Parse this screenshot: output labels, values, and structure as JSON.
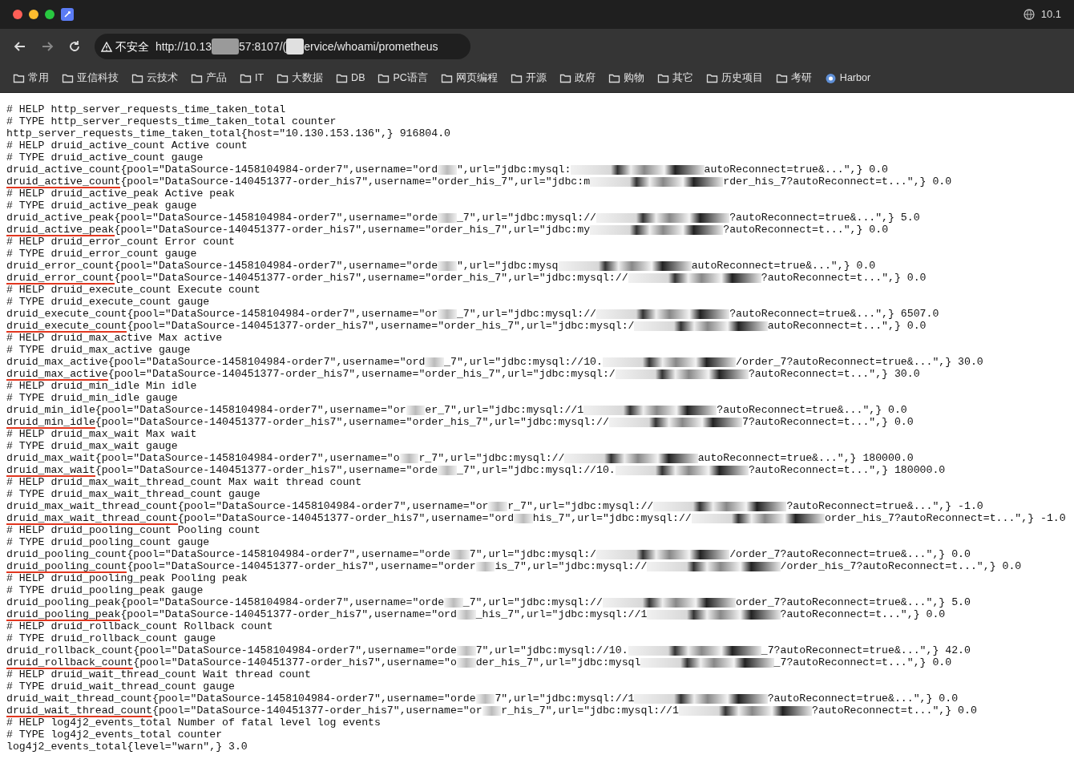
{
  "window": {
    "top_right_text": "10.1"
  },
  "address_bar": {
    "security_label": "不安全",
    "url_parts": [
      "http://10.13",
      "57:8107/(",
      "ervice/whoami/prometheus"
    ]
  },
  "bookmarks": [
    {
      "label": "常用",
      "kind": "folder"
    },
    {
      "label": "亚信科技",
      "kind": "folder"
    },
    {
      "label": "云技术",
      "kind": "folder"
    },
    {
      "label": "产品",
      "kind": "folder"
    },
    {
      "label": "IT",
      "kind": "folder"
    },
    {
      "label": "大数据",
      "kind": "folder"
    },
    {
      "label": "DB",
      "kind": "folder"
    },
    {
      "label": "PC语言",
      "kind": "folder"
    },
    {
      "label": "网页编程",
      "kind": "folder"
    },
    {
      "label": "开源",
      "kind": "folder"
    },
    {
      "label": "政府",
      "kind": "folder"
    },
    {
      "label": "购物",
      "kind": "folder"
    },
    {
      "label": "其它",
      "kind": "folder"
    },
    {
      "label": "历史项目",
      "kind": "folder"
    },
    {
      "label": "考研",
      "kind": "folder"
    },
    {
      "label": "Harbor",
      "kind": "site"
    }
  ],
  "lines": [
    {
      "kind": "comment",
      "text": "# HELP http_server_requests_time_taken_total"
    },
    {
      "kind": "comment",
      "text": "# TYPE http_server_requests_time_taken_total counter"
    },
    {
      "kind": "sample",
      "metric": "http_server_requests_time_taken_total",
      "underlined": false,
      "parts": [
        "{host=\"10.130.153.136\",} 916804.0"
      ]
    },
    {
      "kind": "comment",
      "text": "# HELP druid_active_count Active count"
    },
    {
      "kind": "comment",
      "text": "# TYPE druid_active_count gauge"
    },
    {
      "kind": "sample",
      "metric": "druid_active_count",
      "underlined": false,
      "parts": [
        "{pool=\"DataSource-1458104984-order7\",username=\"ord",
        "\",url=\"jdbc:mysql:",
        "autoReconnect=true&...\",} 0.0"
      ]
    },
    {
      "kind": "sample",
      "metric": "druid_active_count",
      "underlined": true,
      "parts": [
        "{pool=\"DataSource-140451377-order_his7\",username=\"order_his_7\",url=\"jdbc:m",
        "rder_his_7?autoReconnect=t...\",} 0.0"
      ]
    },
    {
      "kind": "comment",
      "text": "# HELP druid_active_peak Active peak"
    },
    {
      "kind": "comment",
      "text": "# TYPE druid_active_peak gauge"
    },
    {
      "kind": "sample",
      "metric": "druid_active_peak",
      "underlined": false,
      "parts": [
        "{pool=\"DataSource-1458104984-order7\",username=\"orde",
        "_7\",url=\"jdbc:mysql://",
        "?autoReconnect=true&...\",} 5.0"
      ]
    },
    {
      "kind": "sample",
      "metric": "druid_active_peak",
      "underlined": true,
      "parts": [
        "{pool=\"DataSource-140451377-order_his7\",username=\"order_his_7\",url=\"jdbc:my",
        "?autoReconnect=t...\",} 0.0"
      ]
    },
    {
      "kind": "comment",
      "text": "# HELP druid_error_count Error count"
    },
    {
      "kind": "comment",
      "text": "# TYPE druid_error_count gauge"
    },
    {
      "kind": "sample",
      "metric": "druid_error_count",
      "underlined": false,
      "parts": [
        "{pool=\"DataSource-1458104984-order7\",username=\"orde",
        "\",url=\"jdbc:mysq",
        "autoReconnect=true&...\",} 0.0"
      ]
    },
    {
      "kind": "sample",
      "metric": "druid_error_count",
      "underlined": true,
      "parts": [
        "{pool=\"DataSource-140451377-order_his7\",username=\"order_his_7\",url=\"jdbc:mysql://",
        "?autoReconnect=t...\",} 0.0"
      ]
    },
    {
      "kind": "comment",
      "text": "# HELP druid_execute_count Execute count"
    },
    {
      "kind": "comment",
      "text": "# TYPE druid_execute_count gauge"
    },
    {
      "kind": "sample",
      "metric": "druid_execute_count",
      "underlined": false,
      "parts": [
        "{pool=\"DataSource-1458104984-order7\",username=\"or",
        "_7\",url=\"jdbc:mysql://",
        "?autoReconnect=true&...\",} 6507.0"
      ]
    },
    {
      "kind": "sample",
      "metric": "druid_execute_count",
      "underlined": true,
      "parts": [
        "{pool=\"DataSource-140451377-order_his7\",username=\"order_his_7\",url=\"jdbc:mysql:/",
        "autoReconnect=t...\",} 0.0"
      ]
    },
    {
      "kind": "comment",
      "text": "# HELP druid_max_active Max active"
    },
    {
      "kind": "comment",
      "text": "# TYPE druid_max_active gauge"
    },
    {
      "kind": "sample",
      "metric": "druid_max_active",
      "underlined": false,
      "parts": [
        "{pool=\"DataSource-1458104984-order7\",username=\"ord",
        "_7\",url=\"jdbc:mysql://10.",
        "/order_7?autoReconnect=true&...\",} 30.0"
      ]
    },
    {
      "kind": "sample",
      "metric": "druid_max_active",
      "underlined": true,
      "parts": [
        "{pool=\"DataSource-140451377-order_his7\",username=\"order_his_7\",url=\"jdbc:mysql:/",
        "?autoReconnect=t...\",} 30.0"
      ]
    },
    {
      "kind": "comment",
      "text": "# HELP druid_min_idle Min idle"
    },
    {
      "kind": "comment",
      "text": "# TYPE druid_min_idle gauge"
    },
    {
      "kind": "sample",
      "metric": "druid_min_idle",
      "underlined": false,
      "parts": [
        "{pool=\"DataSource-1458104984-order7\",username=\"or",
        "er_7\",url=\"jdbc:mysql://1",
        "?autoReconnect=true&...\",} 0.0"
      ]
    },
    {
      "kind": "sample",
      "metric": "druid_min_idle",
      "underlined": true,
      "parts": [
        "{pool=\"DataSource-140451377-order_his7\",username=\"order_his_7\",url=\"jdbc:mysql://",
        "7?autoReconnect=t...\",} 0.0"
      ]
    },
    {
      "kind": "comment",
      "text": "# HELP druid_max_wait Max wait"
    },
    {
      "kind": "comment",
      "text": "# TYPE druid_max_wait gauge"
    },
    {
      "kind": "sample",
      "metric": "druid_max_wait",
      "underlined": false,
      "parts": [
        "{pool=\"DataSource-1458104984-order7\",username=\"o",
        "r_7\",url=\"jdbc:mysql://",
        "autoReconnect=true&...\",} 180000.0"
      ]
    },
    {
      "kind": "sample",
      "metric": "druid_max_wait",
      "underlined": true,
      "parts": [
        "{pool=\"DataSource-140451377-order_his7\",username=\"orde",
        "_7\",url=\"jdbc:mysql://10.",
        "?autoReconnect=t...\",} 180000.0"
      ]
    },
    {
      "kind": "comment",
      "text": "# HELP druid_max_wait_thread_count Max wait thread count"
    },
    {
      "kind": "comment",
      "text": "# TYPE druid_max_wait_thread_count gauge"
    },
    {
      "kind": "sample",
      "metric": "druid_max_wait_thread_count",
      "underlined": false,
      "parts": [
        "{pool=\"DataSource-1458104984-order7\",username=\"or",
        "r_7\",url=\"jdbc:mysql://",
        "?autoReconnect=true&...\",} -1.0"
      ]
    },
    {
      "kind": "sample",
      "metric": "druid_max_wait_thread_count",
      "underlined": true,
      "parts": [
        "{pool=\"DataSource-140451377-order_his7\",username=\"ord",
        "his_7\",url=\"jdbc:mysql://",
        "order_his_7?autoReconnect=t...\",} -1.0"
      ]
    },
    {
      "kind": "comment",
      "text": "# HELP druid_pooling_count Pooling count"
    },
    {
      "kind": "comment",
      "text": "# TYPE druid_pooling_count gauge"
    },
    {
      "kind": "sample",
      "metric": "druid_pooling_count",
      "underlined": false,
      "parts": [
        "{pool=\"DataSource-1458104984-order7\",username=\"orde",
        "7\",url=\"jdbc:mysql:/",
        "/order_7?autoReconnect=true&...\",} 0.0"
      ]
    },
    {
      "kind": "sample",
      "metric": "druid_pooling_count",
      "underlined": true,
      "parts": [
        "{pool=\"DataSource-140451377-order_his7\",username=\"order",
        "is_7\",url=\"jdbc:mysql://",
        "/order_his_7?autoReconnect=t...\",} 0.0"
      ]
    },
    {
      "kind": "comment",
      "text": "# HELP druid_pooling_peak Pooling peak"
    },
    {
      "kind": "comment",
      "text": "# TYPE druid_pooling_peak gauge"
    },
    {
      "kind": "sample",
      "metric": "druid_pooling_peak",
      "underlined": false,
      "parts": [
        "{pool=\"DataSource-1458104984-order7\",username=\"orde",
        "_7\",url=\"jdbc:mysql://",
        "order_7?autoReconnect=true&...\",} 5.0"
      ]
    },
    {
      "kind": "sample",
      "metric": "druid_pooling_peak",
      "underlined": true,
      "parts": [
        "{pool=\"DataSource-140451377-order_his7\",username=\"ord",
        "_his_7\",url=\"jdbc:mysql://1",
        "?autoReconnect=t...\",} 0.0"
      ]
    },
    {
      "kind": "comment",
      "text": "# HELP druid_rollback_count Rollback count"
    },
    {
      "kind": "comment",
      "text": "# TYPE druid_rollback_count gauge"
    },
    {
      "kind": "sample",
      "metric": "druid_rollback_count",
      "underlined": false,
      "parts": [
        "{pool=\"DataSource-1458104984-order7\",username=\"orde",
        "7\",url=\"jdbc:mysql://10.",
        "_7?autoReconnect=true&...\",} 42.0"
      ]
    },
    {
      "kind": "sample",
      "metric": "druid_rollback_count",
      "underlined": true,
      "parts": [
        "{pool=\"DataSource-140451377-order_his7\",username=\"o",
        "der_his_7\",url=\"jdbc:mysql",
        "_7?autoReconnect=t...\",} 0.0"
      ]
    },
    {
      "kind": "comment",
      "text": "# HELP druid_wait_thread_count Wait thread count"
    },
    {
      "kind": "comment",
      "text": "# TYPE druid_wait_thread_count gauge"
    },
    {
      "kind": "sample",
      "metric": "druid_wait_thread_count",
      "underlined": false,
      "parts": [
        "{pool=\"DataSource-1458104984-order7\",username=\"orde",
        "7\",url=\"jdbc:mysql://1",
        "?autoReconnect=true&...\",} 0.0"
      ]
    },
    {
      "kind": "sample",
      "metric": "druid_wait_thread_count",
      "underlined": true,
      "parts": [
        "{pool=\"DataSource-140451377-order_his7\",username=\"or",
        "r_his_7\",url=\"jdbc:mysql://1",
        "?autoReconnect=t...\",} 0.0"
      ]
    },
    {
      "kind": "comment",
      "text": "# HELP log4j2_events_total Number of fatal level log events"
    },
    {
      "kind": "comment",
      "text": "# TYPE log4j2_events_total counter"
    },
    {
      "kind": "sample",
      "metric": "log4j2_events_total",
      "underlined": false,
      "parts": [
        "{level=\"warn\",} 3.0"
      ]
    }
  ]
}
